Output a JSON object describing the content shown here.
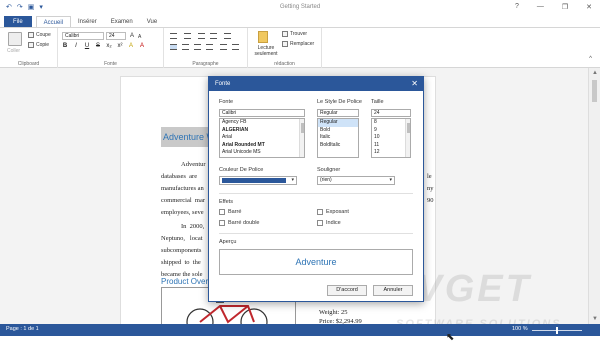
{
  "window": {
    "title": "Getting Started",
    "controls": [
      "?",
      "—",
      "❐",
      "✕"
    ]
  },
  "qat": {
    "undo": "↶",
    "redo": "↷",
    "save": "▣",
    "more": "▾"
  },
  "tabs": [
    {
      "label": "File"
    },
    {
      "label": "Accueil"
    },
    {
      "label": "Insérer"
    },
    {
      "label": "Examen"
    },
    {
      "label": "Vue"
    }
  ],
  "ribbon": {
    "clipboard": {
      "paste_label": "Coller",
      "cut_label": "Coupe",
      "copy_label": "Copie",
      "group_label": "Clipboard"
    },
    "font": {
      "family_value": "Calibri",
      "size_value": "24",
      "group_label": "Fonte",
      "buttons": [
        "B",
        "I",
        "U",
        "S",
        "x₂",
        "x²",
        "A",
        "A"
      ]
    },
    "paragraph": {
      "group_label": "Paragraphe"
    },
    "editing": {
      "readonly_label": "Lecture seulement",
      "find_label": "Trouver",
      "replace_label": "Remplacer",
      "group_label": "rédaction"
    }
  },
  "document": {
    "heading": "Adventure W",
    "para1_lines": [
      "Adventur",
      "databases  are",
      "manufactures an",
      "commercial  mar",
      "employees, seve"
    ],
    "para1_right": [
      "le",
      "ny",
      "90",
      ""
    ],
    "para2_lines": [
      "In  2000,",
      "Neptuno,   locat",
      "subcomponents",
      "shipped  to  the",
      "became the sole"
    ],
    "subheading": "Product Over",
    "spec_weight": "Weight: 25",
    "spec_price": "Price: $2,294.99"
  },
  "dialog": {
    "title": "Fonte",
    "close": "✕",
    "font_label": "Fonte",
    "font_value": "Calibri",
    "font_list": [
      {
        "name": "Agency FB",
        "bold": false
      },
      {
        "name": "ALGERIAN",
        "bold": true
      },
      {
        "name": "Arial",
        "bold": false
      },
      {
        "name": "Arial Rounded MT",
        "bold": true
      },
      {
        "name": "Arial Unicode MS",
        "bold": false
      }
    ],
    "style_label": "Le Style De Police",
    "style_value": "Regular",
    "style_list": [
      "Regular",
      "Bold",
      "Italic",
      "BoldItalic"
    ],
    "size_label": "Taille",
    "size_value": "24",
    "size_list": [
      "8",
      "9",
      "10",
      "11",
      "12"
    ],
    "color_label": "Couleur De Police",
    "color_value": "#2b579a",
    "underline_label": "Souligner",
    "underline_value": "(rien)",
    "effects_label": "Effets",
    "strike_label": "Barré",
    "double_strike_label": "Barré double",
    "superscript_label": "Exposant",
    "subscript_label": "Indice",
    "preview_label": "Aperçu",
    "preview_text": "Adventure",
    "ok_label": "D'accord",
    "cancel_label": "Annuler"
  },
  "status": {
    "page": "Page : 1 de 1",
    "zoom": "100 %"
  },
  "watermark": {
    "main": "EVGET",
    "sub": "SOFTWARE SOLUTIONS"
  },
  "colors": {
    "accent": "#2b579a",
    "heading": "#2e74b5"
  }
}
